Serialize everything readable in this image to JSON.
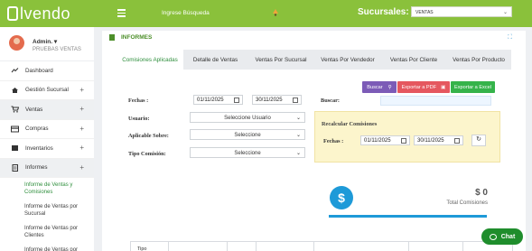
{
  "app": {
    "brand": "lvendo"
  },
  "header": {
    "search_label": "Ingrese Búsqueda",
    "sucursales_label": "Sucursales:",
    "branch_selected": "VENTAS"
  },
  "sidebar": {
    "user_name": "Admin. ▾",
    "user_branch": "PRUEBAS VENTAS",
    "items": [
      {
        "label": "Dashboard",
        "plus": ""
      },
      {
        "label": "Gestión Sucursal",
        "plus": "+"
      },
      {
        "label": "Ventas",
        "plus": "+"
      },
      {
        "label": "Compras",
        "plus": "+"
      },
      {
        "label": "Inventarios",
        "plus": "+"
      },
      {
        "label": "Informes",
        "plus": "+"
      }
    ],
    "subitems": [
      "Informe de Ventas y Comisiones",
      "Informe de Ventas por Sucursal",
      "Informe de Ventas por Clientes",
      "Informe de Ventas por"
    ]
  },
  "main": {
    "title": "INFORMES",
    "expand_icon": "⛶",
    "tabs": [
      "Comisiones Aplicadas",
      "Detalle de Ventas",
      "Ventas Por Sucursal",
      "Ventas Por Vendedor",
      "Ventas Por Cliente",
      "Ventas Por Producto"
    ]
  },
  "filters": {
    "fechas_label": "Fechas :",
    "date_from": "01/11/2025",
    "date_to": "30/11/2025",
    "buscar_label": "Buscar:",
    "usuario_label": "Usuario:",
    "usuario_value": "Seleccione Usuario",
    "aplicable_label": "Aplicable Sobre:",
    "aplicable_value": "Seleccione",
    "tipo_label": "Tipo Comisión:",
    "tipo_value": "Seleccione",
    "btn_buscar": "Buscar",
    "btn_pdf": "Exportar a PDF",
    "btn_excel": "Exportar a Excel"
  },
  "recalc": {
    "title": "Recalcular Comisiones",
    "fechas_label": "Fechas :",
    "date_from": "01/11/2025",
    "date_to": "30/11/2025"
  },
  "kpi": {
    "symbol": "$",
    "value": "$ 0",
    "label": "Total Comisiones"
  },
  "table": {
    "first_header": "Tipo"
  },
  "chat": {
    "label": "Chat"
  }
}
